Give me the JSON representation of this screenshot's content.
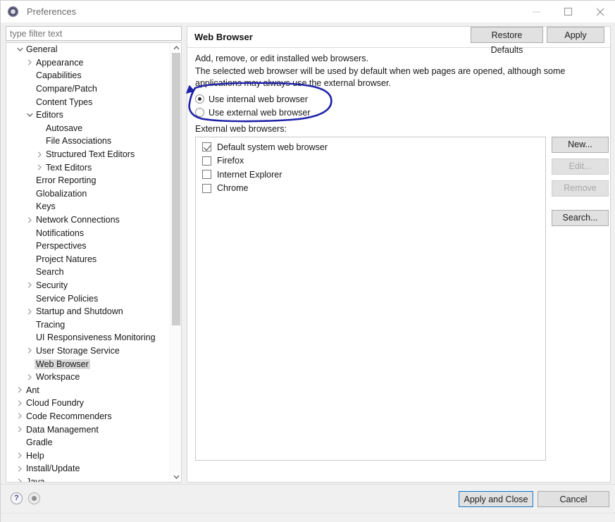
{
  "window": {
    "title": "Preferences",
    "icon": "preferences-gear-icon",
    "controls": [
      {
        "name": "minimize",
        "glyph": "minimize-icon"
      },
      {
        "name": "maximize",
        "glyph": "maximize-icon"
      },
      {
        "name": "close",
        "glyph": "close-icon"
      }
    ]
  },
  "filter": {
    "placeholder": "type filter text",
    "value": ""
  },
  "tree": {
    "items": [
      {
        "label": "General",
        "depth": 0,
        "twisty": "expanded"
      },
      {
        "label": "Appearance",
        "depth": 1,
        "twisty": "collapsed"
      },
      {
        "label": "Capabilities",
        "depth": 1,
        "twisty": "none"
      },
      {
        "label": "Compare/Patch",
        "depth": 1,
        "twisty": "none"
      },
      {
        "label": "Content Types",
        "depth": 1,
        "twisty": "none"
      },
      {
        "label": "Editors",
        "depth": 1,
        "twisty": "expanded"
      },
      {
        "label": "Autosave",
        "depth": 2,
        "twisty": "none"
      },
      {
        "label": "File Associations",
        "depth": 2,
        "twisty": "none"
      },
      {
        "label": "Structured Text Editors",
        "depth": 2,
        "twisty": "collapsed"
      },
      {
        "label": "Text Editors",
        "depth": 2,
        "twisty": "collapsed"
      },
      {
        "label": "Error Reporting",
        "depth": 1,
        "twisty": "none"
      },
      {
        "label": "Globalization",
        "depth": 1,
        "twisty": "none"
      },
      {
        "label": "Keys",
        "depth": 1,
        "twisty": "none"
      },
      {
        "label": "Network Connections",
        "depth": 1,
        "twisty": "collapsed"
      },
      {
        "label": "Notifications",
        "depth": 1,
        "twisty": "none"
      },
      {
        "label": "Perspectives",
        "depth": 1,
        "twisty": "none"
      },
      {
        "label": "Project Natures",
        "depth": 1,
        "twisty": "none"
      },
      {
        "label": "Search",
        "depth": 1,
        "twisty": "none"
      },
      {
        "label": "Security",
        "depth": 1,
        "twisty": "collapsed"
      },
      {
        "label": "Service Policies",
        "depth": 1,
        "twisty": "none"
      },
      {
        "label": "Startup and Shutdown",
        "depth": 1,
        "twisty": "collapsed"
      },
      {
        "label": "Tracing",
        "depth": 1,
        "twisty": "none"
      },
      {
        "label": "UI Responsiveness Monitoring",
        "depth": 1,
        "twisty": "none"
      },
      {
        "label": "User Storage Service",
        "depth": 1,
        "twisty": "collapsed"
      },
      {
        "label": "Web Browser",
        "depth": 1,
        "twisty": "none",
        "selected": true
      },
      {
        "label": "Workspace",
        "depth": 1,
        "twisty": "collapsed"
      },
      {
        "label": "Ant",
        "depth": 0,
        "twisty": "collapsed"
      },
      {
        "label": "Cloud Foundry",
        "depth": 0,
        "twisty": "collapsed"
      },
      {
        "label": "Code Recommenders",
        "depth": 0,
        "twisty": "collapsed"
      },
      {
        "label": "Data Management",
        "depth": 0,
        "twisty": "collapsed"
      },
      {
        "label": "Gradle",
        "depth": 0,
        "twisty": "none"
      },
      {
        "label": "Help",
        "depth": 0,
        "twisty": "collapsed"
      },
      {
        "label": "Install/Update",
        "depth": 0,
        "twisty": "collapsed"
      },
      {
        "label": "Java",
        "depth": 0,
        "twisty": "collapsed"
      }
    ],
    "scrollbar": {
      "up_arrow": "chevron-up-icon",
      "down_arrow": "chevron-down-icon"
    }
  },
  "panel": {
    "title": "Web Browser",
    "nav": [
      {
        "name": "back-icon",
        "label": ""
      },
      {
        "name": "back-dropdown-icon",
        "label": ""
      },
      {
        "name": "forward-icon",
        "label": ""
      },
      {
        "name": "forward-dropdown-icon",
        "label": ""
      },
      {
        "name": "view-menu-icon",
        "label": ""
      }
    ],
    "description": "Add, remove, or edit installed web browsers.\nThe selected web browser will be used by default when web pages are opened, although some applications may always use the external browser.",
    "radio_options": [
      {
        "label": "Use internal web browser",
        "selected": true
      },
      {
        "label": "Use external web browser",
        "selected": false
      }
    ],
    "list_label": "External web browsers:",
    "browsers": [
      {
        "label": "Default system web browser",
        "checked": true
      },
      {
        "label": "Firefox",
        "checked": false
      },
      {
        "label": "Internet Explorer",
        "checked": false
      },
      {
        "label": "Chrome",
        "checked": false
      }
    ],
    "side_buttons": [
      {
        "label": "New...",
        "enabled": true
      },
      {
        "label": "Edit...",
        "enabled": false
      },
      {
        "label": "Remove",
        "enabled": false
      },
      {
        "label": "Search...",
        "enabled": true
      }
    ],
    "footer_buttons": [
      {
        "label": "Restore Defaults"
      },
      {
        "label": "Apply"
      }
    ]
  },
  "bottom_bar": {
    "help_icon": "question-mark-icon",
    "record_icon": "record-icon",
    "apply_and_close": "Apply and Close",
    "cancel": "Cancel"
  },
  "annotation": {
    "color": "#1f23a8",
    "shape": "hand-drawn-ellipse-with-arrow",
    "target": "radio-group"
  },
  "colors": {
    "accent": "#0a6ebd",
    "annotation": "#1f23a8",
    "panel_bg": "#ffffff",
    "window_bg": "#f0f0f0",
    "button_bg": "#e1e1e1",
    "selection_bg": "#d9d9d9"
  }
}
